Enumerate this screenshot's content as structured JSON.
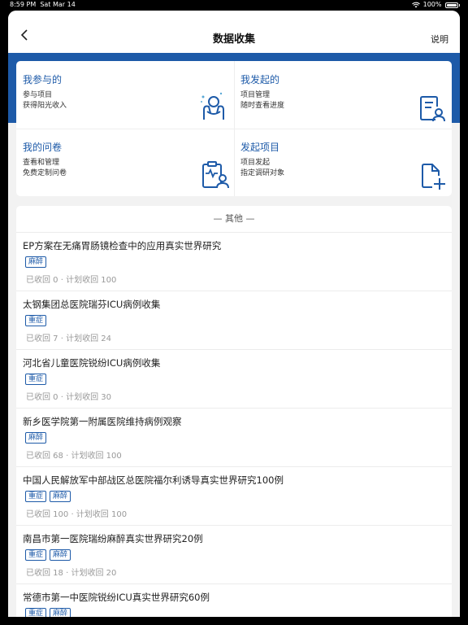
{
  "status": {
    "time": "8:59 PM",
    "date": "Sat Mar 14",
    "battery": "100%"
  },
  "nav": {
    "title": "数据收集",
    "help": "说明"
  },
  "grid": [
    {
      "title": "我参与的",
      "line1": "参与项目",
      "line2": "获得阳光收入",
      "icon": "hands-heart-icon"
    },
    {
      "title": "我发起的",
      "line1": "项目管理",
      "line2": "随时查看进度",
      "icon": "document-user-icon"
    },
    {
      "title": "我的问卷",
      "line1": "查看和管理",
      "line2": "免费定制问卷",
      "icon": "clipboard-user-icon"
    },
    {
      "title": "发起项目",
      "line1": "项目发起",
      "line2": "指定调研对象",
      "icon": "document-add-icon"
    }
  ],
  "others_label": "— 其他 —",
  "items": [
    {
      "title": "EP方案在无痛胃肠镜检查中的应用真实世界研究",
      "tags": [
        "麻醉"
      ],
      "meta": "已收回 0 · 计划收回 100"
    },
    {
      "title": "太钢集团总医院瑞芬ICU病例收集",
      "tags": [
        "重症"
      ],
      "meta": "已收回 7 · 计划收回 24"
    },
    {
      "title": "河北省儿童医院锐纷ICU病例收集",
      "tags": [
        "重症"
      ],
      "meta": "已收回 0 · 计划收回 30"
    },
    {
      "title": "新乡医学院第一附属医院维持病例观察",
      "tags": [
        "麻醉"
      ],
      "meta": "已收回 68 · 计划收回 100"
    },
    {
      "title": "中国人民解放军中部战区总医院福尔利诱导真实世界研究100例",
      "tags": [
        "重症",
        "麻醉"
      ],
      "meta": "已收回 100 · 计划收回 100"
    },
    {
      "title": "南昌市第一医院瑞纷麻醉真实世界研究20例",
      "tags": [
        "重症",
        "麻醉"
      ],
      "meta": "已收回 18 · 计划收回 20"
    },
    {
      "title": "常德市第一中医院锐纷ICU真实世界研究60例",
      "tags": [
        "重症",
        "麻醉"
      ],
      "meta": ""
    }
  ],
  "colors": {
    "accent": "#1d5aa8",
    "background": "#f2f2f2"
  }
}
